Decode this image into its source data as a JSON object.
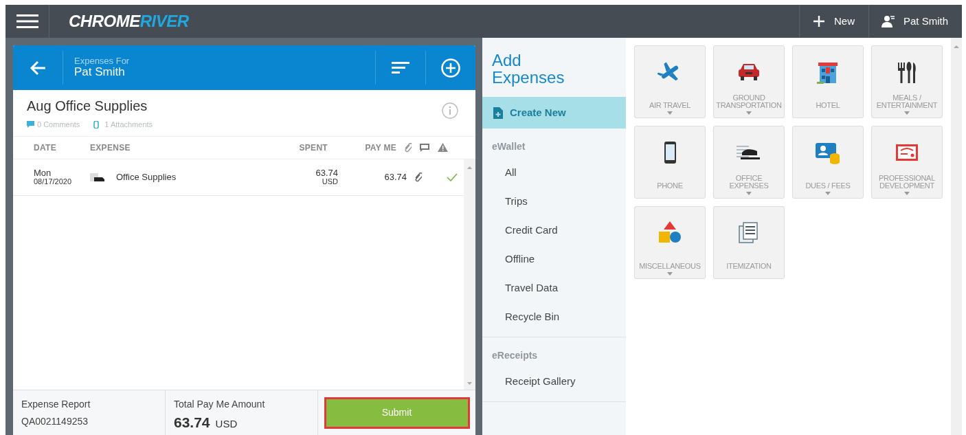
{
  "topbar": {
    "logo_main": "CHROME",
    "logo_accent": "RIVER",
    "new_label": "New",
    "user": "Pat Smith"
  },
  "report_panel": {
    "header_caption": "Expenses For",
    "header_name": "Pat Smith",
    "title": "Aug Office Supplies",
    "comments": "0 Comments",
    "attachments": "1 Attachments",
    "columns": [
      "DATE",
      "EXPENSE",
      "SPENT",
      "PAY ME"
    ],
    "rows": [
      {
        "day": "Mon",
        "date": "08/17/2020",
        "expense": "Office Supplies",
        "spent": "63.74",
        "currency": "USD",
        "pay_me": "63.74",
        "has_attachment": true,
        "valid": true
      }
    ],
    "footer": {
      "report_label": "Expense Report",
      "report_id": "QA0021149253",
      "total_label": "Total Pay Me Amount",
      "total": "63.74",
      "total_currency": "USD",
      "submit": "Submit",
      "submit_highlighted": true
    }
  },
  "sidebar": {
    "title": "Add Expenses",
    "create_new": {
      "label": "Create New",
      "selected": true
    },
    "sections": [
      {
        "heading": "eWallet",
        "items": [
          {
            "label": "All",
            "selected": false
          },
          {
            "label": "Trips",
            "selected": false
          },
          {
            "label": "Credit Card",
            "selected": false
          },
          {
            "label": "Offline",
            "selected": false
          },
          {
            "label": "Travel Data",
            "selected": false
          },
          {
            "label": "Recycle Bin",
            "selected": false
          }
        ]
      },
      {
        "heading": "eReceipts",
        "items": [
          {
            "label": "Receipt Gallery",
            "selected": false
          }
        ]
      }
    ]
  },
  "tiles": [
    {
      "label": "AIR TRAVEL",
      "expandable": true
    },
    {
      "label": "GROUND TRANSPORTATION",
      "expandable": true
    },
    {
      "label": "HOTEL",
      "expandable": false
    },
    {
      "label": "MEALS / ENTERTAINMENT",
      "expandable": true
    },
    {
      "label": "PHONE",
      "expandable": false
    },
    {
      "label": "OFFICE EXPENSES",
      "expandable": true
    },
    {
      "label": "DUES / FEES",
      "expandable": true
    },
    {
      "label": "PROFESSIONAL DEVELOPMENT",
      "expandable": true
    },
    {
      "label": "MISCELLANEOUS",
      "expandable": true
    },
    {
      "label": "ITEMIZATION",
      "expandable": false
    }
  ]
}
